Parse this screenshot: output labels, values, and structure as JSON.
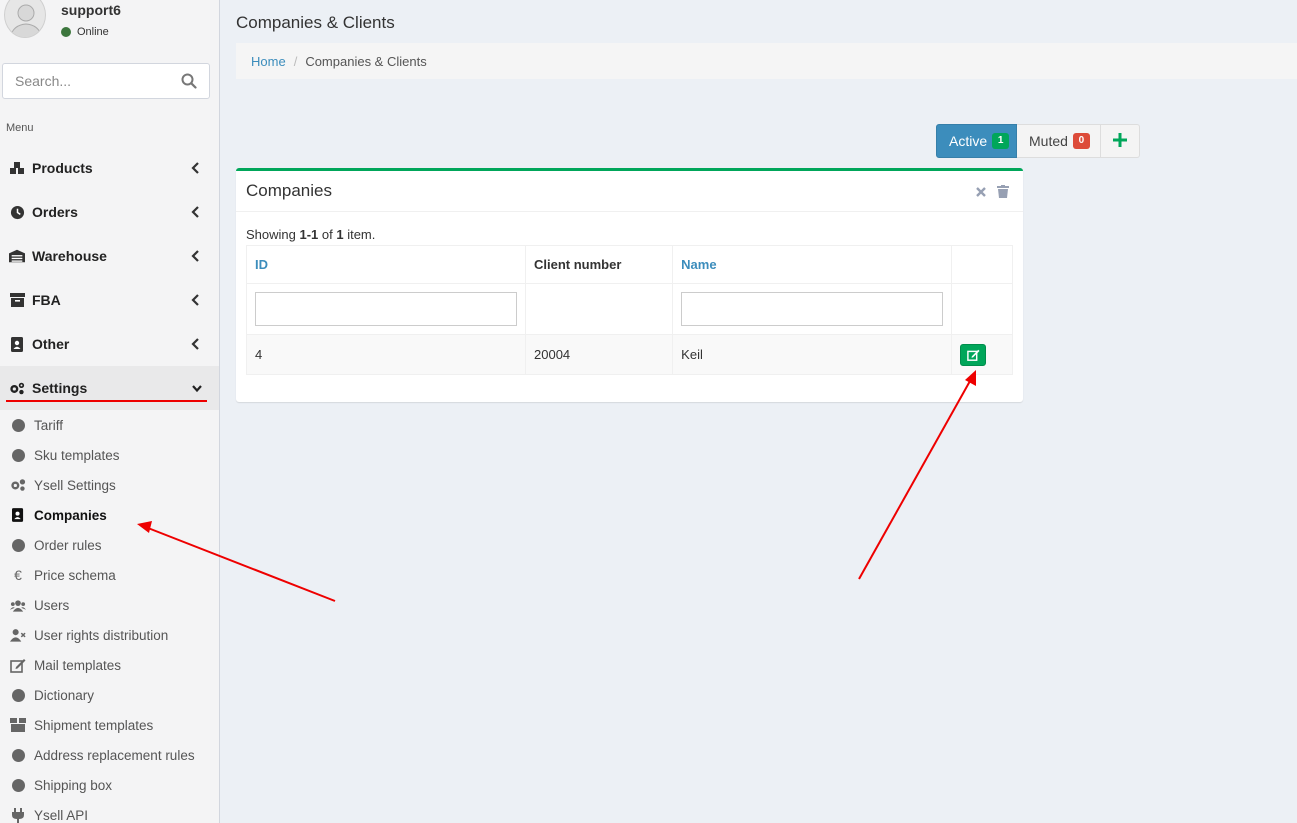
{
  "user": {
    "name": "support6",
    "status": "Online"
  },
  "search": {
    "placeholder": "Search..."
  },
  "menu": {
    "header": "Menu",
    "items": [
      {
        "label": "Products",
        "icon": "cubes-icon"
      },
      {
        "label": "Orders",
        "icon": "clock-icon"
      },
      {
        "label": "Warehouse",
        "icon": "warehouse-icon"
      },
      {
        "label": "FBA",
        "icon": "archive-icon"
      },
      {
        "label": "Other",
        "icon": "address-book-icon"
      },
      {
        "label": "Settings",
        "icon": "cogs-icon",
        "open": true
      }
    ],
    "settings_items": [
      {
        "label": "Tariff",
        "icon": "circle-icon"
      },
      {
        "label": "Sku templates",
        "icon": "circle-icon"
      },
      {
        "label": "Ysell Settings",
        "icon": "cogs-icon"
      },
      {
        "label": "Companies",
        "icon": "address-book-icon",
        "active": true
      },
      {
        "label": "Order rules",
        "icon": "circle-icon"
      },
      {
        "label": "Price schema",
        "icon": "euro-icon"
      },
      {
        "label": "Users",
        "icon": "users-icon"
      },
      {
        "label": "User rights distribution",
        "icon": "user-times-icon"
      },
      {
        "label": "Mail templates",
        "icon": "edit-icon"
      },
      {
        "label": "Dictionary",
        "icon": "circle-icon"
      },
      {
        "label": "Shipment templates",
        "icon": "box-icon"
      },
      {
        "label": "Address replacement rules",
        "icon": "circle-icon"
      },
      {
        "label": "Shipping box",
        "icon": "circle-icon"
      },
      {
        "label": "Ysell API",
        "icon": "plug-icon"
      }
    ]
  },
  "page": {
    "title": "Companies & Clients"
  },
  "breadcrumb": {
    "home": "Home",
    "current": "Companies & Clients"
  },
  "filters": {
    "active_label": "Active",
    "active_count": "1",
    "muted_label": "Muted",
    "muted_count": "0"
  },
  "box": {
    "title": "Companies"
  },
  "summary": {
    "prefix": "Showing ",
    "range": "1-1",
    "of": " of ",
    "total": "1",
    "suffix": " item."
  },
  "table": {
    "headers": [
      "ID",
      "Client number",
      "Name"
    ],
    "rows": [
      {
        "id": "4",
        "client_number": "20004",
        "name": "Keil"
      }
    ]
  },
  "colors": {
    "primary": "#3c8dbc",
    "success": "#00a65a",
    "danger": "#dd4b39",
    "annotation": "#e00000"
  }
}
